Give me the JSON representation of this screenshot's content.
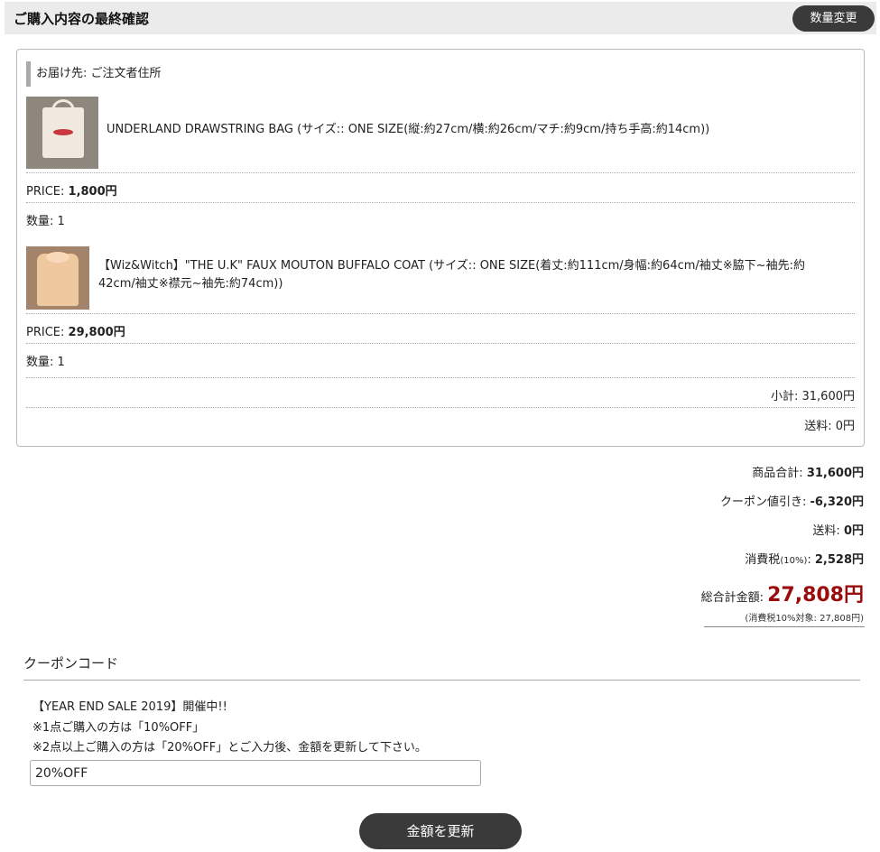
{
  "header": {
    "title": "ご購入内容の最終確認",
    "qty_button": "数量変更"
  },
  "shipping": {
    "label": "お届け先: ご注文者住所"
  },
  "items": [
    {
      "name": "UNDERLAND DRAWSTRING BAG (サイズ:: ONE SIZE(縦:約27cm/横:約26cm/マチ:約9cm/持ち手高:約14cm))",
      "price_label": "PRICE:",
      "price": "1,800円",
      "qty_label": "数量:",
      "qty": "1",
      "image_icon": "tote-bag-photo"
    },
    {
      "name": "【Wiz&Witch】\"THE U.K\" FAUX MOUTON BUFFALO COAT (サイズ:: ONE SIZE(着丈:約111cm/身幅:約64cm/袖丈※脇下~袖先:約42cm/袖丈※襟元~袖先:約74cm))",
      "price_label": "PRICE:",
      "price": "29,800円",
      "qty_label": "数量:",
      "qty": "1",
      "image_icon": "coat-photo"
    }
  ],
  "box_totals": {
    "subtotal": "小計: 31,600円",
    "shipping": "送料: 0円"
  },
  "summary": {
    "goods_label": "商品合計:",
    "goods_value": "31,600円",
    "coupon_label": "クーポン値引き:",
    "coupon_value": "-6,320円",
    "shipping_label": "送料:",
    "shipping_value": "0円",
    "tax_label": "消費税",
    "tax_rate": "(10%)",
    "tax_colon": ":",
    "tax_value": "2,528円",
    "total_label": "総合計金額:",
    "total_value": "27,808円",
    "tax_note": "(消費税10%対象: 27,808円)"
  },
  "coupon": {
    "title": "クーポンコード",
    "lines": [
      "【YEAR END SALE 2019】開催中!!",
      "※1点ご購入の方は「10%OFF」",
      "※2点以上ご購入の方は「20%OFF」とご入力後、金額を更新して下さい。"
    ],
    "input_value": "20%OFF",
    "update_button": "金額を更新"
  },
  "colors": {
    "total_red": "#9a0b0b",
    "button_dark": "#3a3a3a",
    "header_bg": "#ebebeb"
  }
}
